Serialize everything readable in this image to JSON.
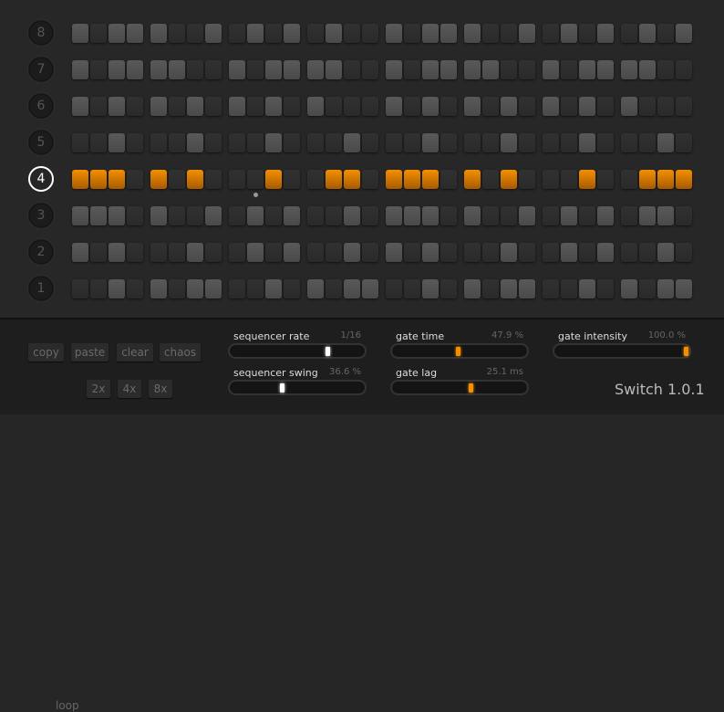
{
  "rows": [
    {
      "label": "8",
      "pattern": "10111001010101001011100101010101"
    },
    {
      "label": "7",
      "pattern": "10111100101111001011110010111100"
    },
    {
      "label": "6",
      "pattern": "10101010101010001010101010101000"
    },
    {
      "label": "5",
      "pattern": "00100010001000100010001000100010"
    },
    {
      "label": "4",
      "pattern": "11101010001001101110101000100111",
      "selected": true
    },
    {
      "label": "3",
      "pattern": "11101001010100101110100101010110"
    },
    {
      "label": "2",
      "pattern": "10100010010100101010001001010010"
    },
    {
      "label": "1",
      "pattern": "00101011001010110010101100101011"
    }
  ],
  "playhead_step": 9,
  "buttons": {
    "copy": "copy",
    "paste": "paste",
    "clear": "clear",
    "chaos": "chaos"
  },
  "loop": {
    "label": "loop",
    "options": [
      "2x",
      "4x",
      "8x"
    ]
  },
  "sliders": {
    "rate": {
      "label": "sequencer rate",
      "value": "1/16",
      "fraction": 0.73
    },
    "swing": {
      "label": "sequencer swing",
      "value": "36.6 %",
      "fraction": 0.366
    },
    "gate_time": {
      "label": "gate time",
      "value": "47.9 %",
      "fraction": 0.479
    },
    "gate_lag": {
      "label": "gate lag",
      "value": "25.1 ms",
      "fraction": 0.58
    },
    "gate_intensity": {
      "label": "gate intensity",
      "value": "100.0 %",
      "fraction": 1.0
    }
  },
  "title": "Switch 1.0.1",
  "colors": {
    "accent": "#f49000"
  }
}
